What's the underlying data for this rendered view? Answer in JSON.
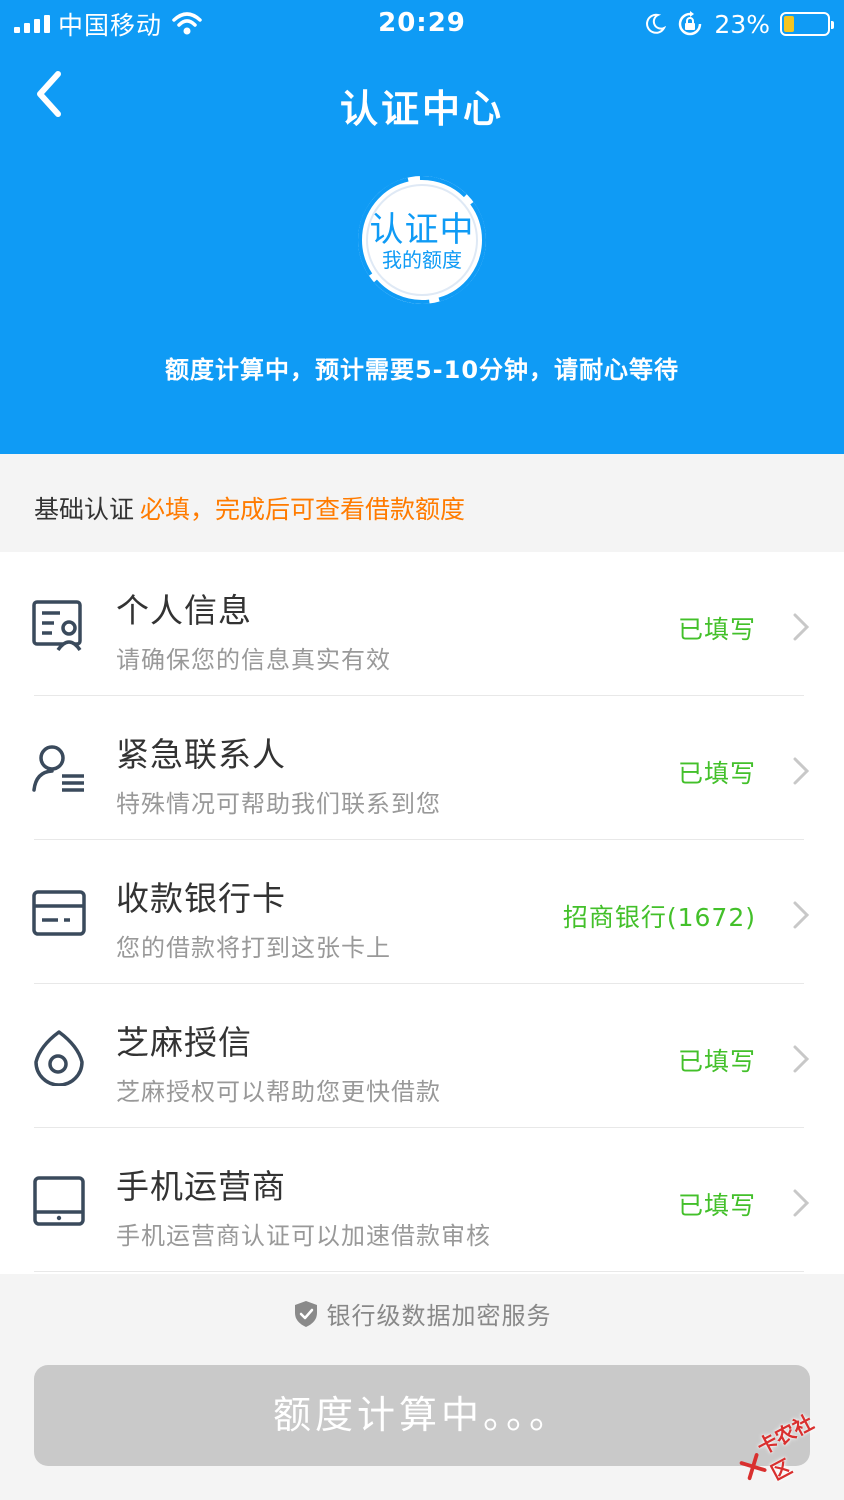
{
  "status_bar": {
    "carrier": "中国移动",
    "time": "20:29",
    "battery_percent": "23%",
    "battery_level": 0.23
  },
  "nav": {
    "title": "认证中心"
  },
  "badge": {
    "main": "认证中",
    "sub": "我的额度"
  },
  "calc_message": "额度计算中，预计需要5-10分钟，请耐心等待",
  "section": {
    "title": "基础认证",
    "note": "必填，完成后可查看借款额度"
  },
  "items": [
    {
      "icon": "personal-info-icon",
      "title": "个人信息",
      "subtitle": "请确保您的信息真实有效",
      "status": "已填写"
    },
    {
      "icon": "contact-icon",
      "title": "紧急联系人",
      "subtitle": "特殊情况可帮助我们联系到您",
      "status": "已填写"
    },
    {
      "icon": "bank-card-icon",
      "title": "收款银行卡",
      "subtitle": "您的借款将打到这张卡上",
      "status": "招商银行(1672)"
    },
    {
      "icon": "sesame-icon",
      "title": "芝麻授信",
      "subtitle": "芝麻授权可以帮助您更快借款",
      "status": "已填写"
    },
    {
      "icon": "mobile-carrier-icon",
      "title": "手机运营商",
      "subtitle": "手机运营商认证可以加速借款审核",
      "status": "已填写"
    }
  ],
  "footer": {
    "secure_text": "银行级数据加密服务",
    "button_label": "额度计算中。。。"
  },
  "watermark": "卡农社区",
  "colors": {
    "primary": "#0f9bf5",
    "accent_orange": "#ff7b00",
    "status_green": "#43c02a",
    "button_disabled": "#c9c9c9"
  }
}
